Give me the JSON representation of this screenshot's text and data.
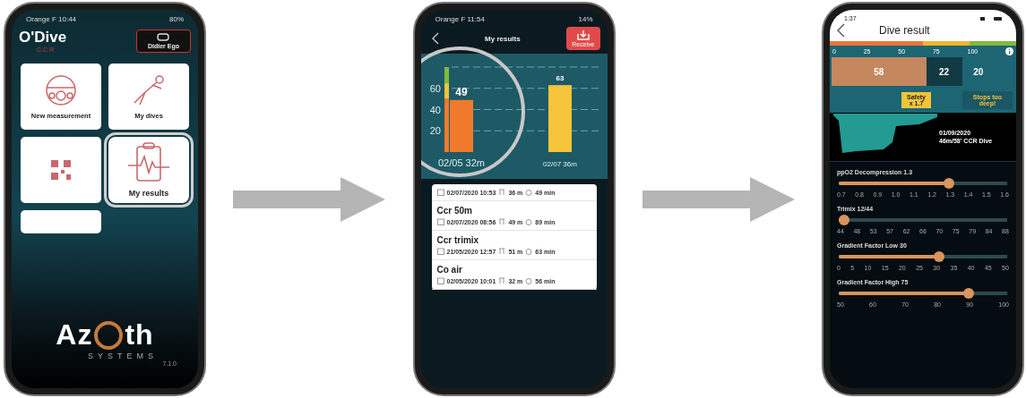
{
  "home_screen": {
    "status": {
      "carrier": "Orange F",
      "time": "10:44",
      "battery": "80%"
    },
    "logo": {
      "name": "O'Dive",
      "sub": "CCR"
    },
    "user_button": "Didier Ego",
    "tiles": [
      {
        "kind": "helmet",
        "label": "New measurement",
        "magnified": false
      },
      {
        "kind": "diver",
        "label": "My dives",
        "magnified": false
      },
      {
        "kind": "qr",
        "magnified": false
      },
      {
        "kind": "results",
        "label": "My results",
        "magnified": true
      },
      {
        "kind": "blank",
        "magnified": false
      }
    ],
    "brand": {
      "left": "Az",
      "right": "th",
      "sub": "SYSTEMS"
    },
    "version": "7.1.0"
  },
  "results_screen": {
    "status": {
      "carrier": "Orange F",
      "time": "11:54",
      "battery": "14%"
    },
    "title": "My results",
    "receive_button": "Receive",
    "chart_data": {
      "type": "bar",
      "categories": [
        "02/05 32m",
        "02/07 36m"
      ],
      "series": [
        {
          "color": "#f07a2c",
          "values": [
            49,
            null
          ]
        },
        {
          "color": "#f5c43a",
          "values": [
            null,
            63
          ]
        }
      ],
      "yticks": [
        20,
        40,
        60
      ],
      "ylim": [
        0,
        80
      ],
      "grid": true,
      "data_labels": true
    },
    "dives": [
      {
        "date": "02/07/2020 10:53",
        "depth": "36 m",
        "duration": "49 min"
      },
      {
        "title": "Ccr 50m",
        "date": "02/07/2020 08:56",
        "depth": "49 m",
        "duration": "89 min"
      },
      {
        "title": "Ccr trimix",
        "date": "21/05/2020 12:57",
        "depth": "51 m",
        "duration": "63 min"
      },
      {
        "title": "Co air",
        "date": "02/05/2020 10:01",
        "depth": "32 m",
        "duration": "56 min"
      }
    ]
  },
  "dive_result_screen": {
    "status": {
      "time": "1:37"
    },
    "title": "Dive result",
    "scale_zones": [
      {
        "color": "#e8773a"
      },
      {
        "color": "#f2b52a"
      },
      {
        "color": "#7fba3f"
      }
    ],
    "scale_ticks": [
      "0",
      "25",
      "50",
      "75",
      "100"
    ],
    "segments": [
      {
        "value": "58",
        "color": "#c4875e"
      },
      {
        "value": "22",
        "color": "#123a44"
      },
      {
        "value": "20",
        "color": "#1d6573"
      }
    ],
    "safety_badge": [
      "Safety",
      "x 1.7"
    ],
    "warning": "Stops too deep!",
    "profile": {
      "date": "01/09/2020",
      "description": "46m/58' CCR Dive"
    },
    "sliders": [
      {
        "label": "ppO2 Decompression 1.3",
        "level": 0.667,
        "ticks": [
          "0.7",
          "0.8",
          "0.9",
          "1.0",
          "1.1",
          "1.2",
          "1.3",
          "1.4",
          "1.5",
          "1.6"
        ]
      },
      {
        "label": "Trimix 12/44",
        "level": 0,
        "ticks": [
          "44",
          "48",
          "53",
          "57",
          "62",
          "66",
          "70",
          "75",
          "79",
          "84",
          "88"
        ]
      },
      {
        "label": "Gradient Factor Low  30",
        "level": 0.6,
        "ticks": [
          "0",
          "5",
          "10",
          "15",
          "20",
          "25",
          "30",
          "35",
          "40",
          "45",
          "50"
        ]
      },
      {
        "label": "Gradient Factor High  75",
        "level": 0.79,
        "ticks": [
          "50",
          "60",
          "70",
          "80",
          "90",
          "100"
        ]
      }
    ]
  }
}
